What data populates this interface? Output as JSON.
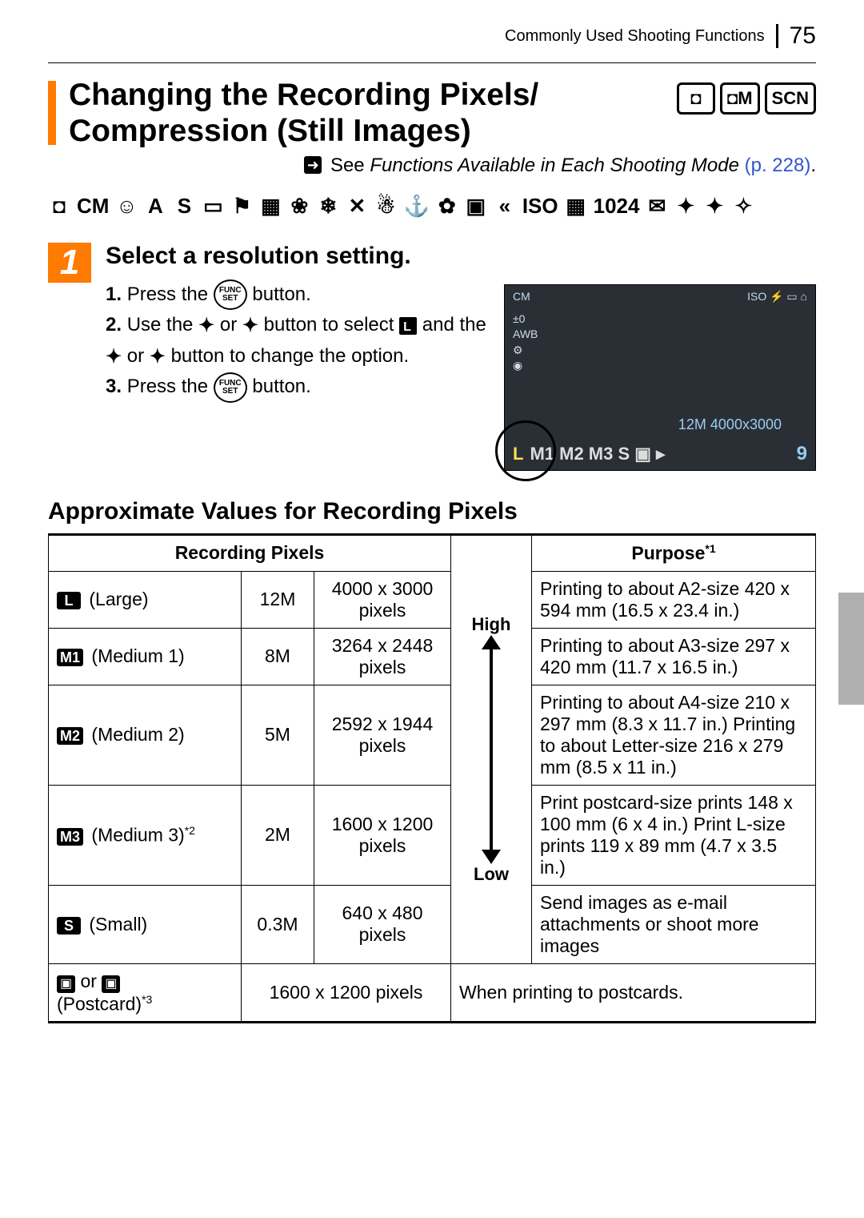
{
  "running_head": "Commonly Used Shooting Functions",
  "page_number": "75",
  "title": "Changing the Recording Pixels/ Compression (Still Images)",
  "mode_badges": [
    "◘",
    "◘M",
    "SCN"
  ],
  "see_prefix": "See ",
  "see_text": "Functions Available in Each Shooting Mode",
  "see_link": "(p. 228)",
  "see_suffix": ".",
  "step": {
    "num": "1",
    "title": "Select a resolution setting.",
    "items": {
      "n1": "1.",
      "l1a": "Press the ",
      "l1b": " button.",
      "n2": "2.",
      "l2a": "Use the ",
      "l2or": " or ",
      "l2b": " button to select ",
      "l2c": " and the ",
      "l2d": " button to change the option.",
      "n3": "3.",
      "l3a": "Press the ",
      "l3b": " button.",
      "func_top": "FUNC",
      "func_bot": "SET"
    }
  },
  "screenshot": {
    "top_left": "CM",
    "top_right": "ISO ⚡ ▭ ⌂",
    "side": "±0\nAWB\n⚙︎\n◉",
    "info": "12M 4000x3000",
    "bottom_sel": "L",
    "bottom_rest": "M1 M2 M3 S ▣ ▸",
    "bottom_num": "9"
  },
  "subhead": "Approximate Values for Recording Pixels",
  "table": {
    "head_px": "Recording Pixels",
    "head_purpose": "Purpose",
    "head_purpose_sup": "*1",
    "qual_high": "High",
    "qual_low": "Low",
    "rows": [
      {
        "icon": "L",
        "name": "(Large)",
        "mp": "12M",
        "px": "4000 x 3000 pixels",
        "purpose": "Printing to about A2-size 420 x 594 mm (16.5 x 23.4 in.)"
      },
      {
        "icon": "M1",
        "name": "(Medium 1)",
        "mp": "8M",
        "px": "3264 x 2448 pixels",
        "purpose": "Printing to about A3-size 297 x 420 mm (11.7 x 16.5 in.)"
      },
      {
        "icon": "M2",
        "name": "(Medium 2)",
        "mp": "5M",
        "px": "2592 x 1944 pixels",
        "purpose": "Printing to about A4-size 210 x 297 mm (8.3 x 11.7 in.) Printing to about Letter-size 216 x 279 mm (8.5 x 11 in.)"
      },
      {
        "icon": "M3",
        "name": "(Medium 3)",
        "name_sup": "*2",
        "mp": "2M",
        "px": "1600 x 1200 pixels",
        "purpose": "Print postcard-size prints 148 x 100 mm (6 x 4 in.) Print L-size prints 119 x 89 mm (4.7 x 3.5 in.)"
      },
      {
        "icon": "S",
        "name": "(Small)",
        "mp": "0.3M",
        "px": "640 x 480 pixels",
        "purpose": "Send images as e-mail attachments or shoot more images"
      }
    ],
    "postcard": {
      "label_a": "▣",
      "label_or": " or ",
      "label_b": "▣",
      "label_text": "(Postcard)",
      "label_sup": "*3",
      "px": "1600 x 1200 pixels",
      "purpose": "When printing to postcards."
    }
  }
}
